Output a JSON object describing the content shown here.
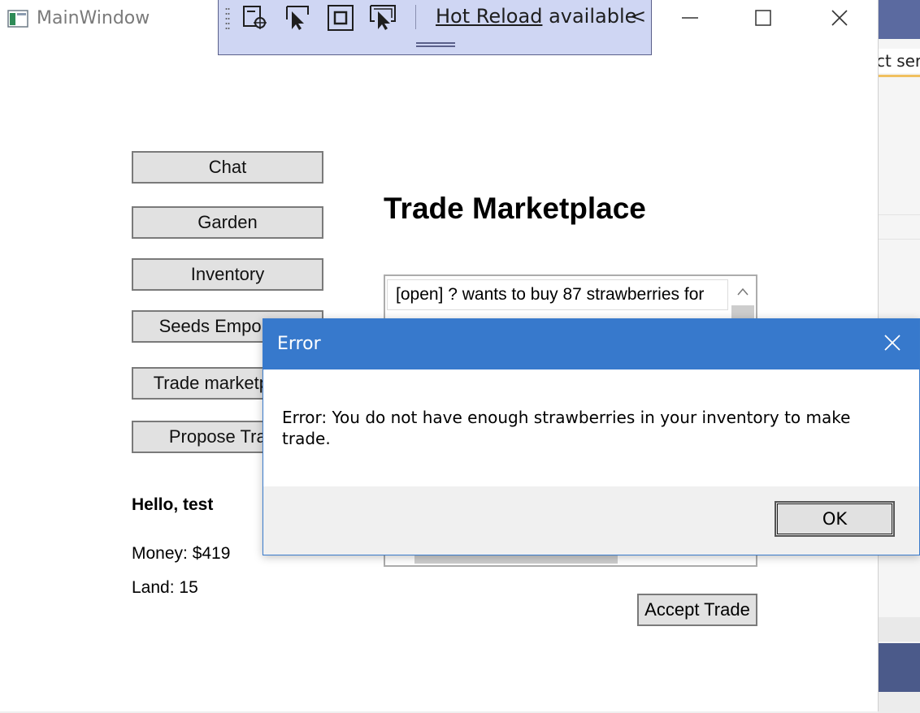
{
  "window": {
    "title": "MainWindow",
    "controls": {
      "minimize": "minimize",
      "maximize": "maximize",
      "close": "close"
    }
  },
  "hot_reload": {
    "link_text": "Hot Reload",
    "suffix_text": " available",
    "collapse_glyph": "<",
    "icons": [
      "select-element-icon",
      "pointer-select-icon",
      "layout-adorner-icon",
      "track-focus-icon"
    ]
  },
  "nav": {
    "buttons": [
      {
        "label": "Chat"
      },
      {
        "label": "Garden"
      },
      {
        "label": "Inventory"
      },
      {
        "label": "Seeds Emporium"
      },
      {
        "label": "Trade marketplace"
      },
      {
        "label": "Propose Trade"
      }
    ]
  },
  "user": {
    "greeting": "Hello, test",
    "money": "Money: $419",
    "land": "Land: 15"
  },
  "marketplace": {
    "heading": "Trade Marketplace",
    "items": [
      "[open] ? wants to buy 87 strawberries for"
    ],
    "accept_label": "Accept Trade"
  },
  "dialog": {
    "title": "Error",
    "message": "Error: You do not have enough strawberries in your inventory to make trade.",
    "ok_label": "OK"
  },
  "background_ide": {
    "partial_text": "ct ser"
  },
  "colors": {
    "dialog_title_bg": "#3779cc",
    "toolbar_bg": "#cfd6f3",
    "ide_band": "#4b5a8a"
  }
}
